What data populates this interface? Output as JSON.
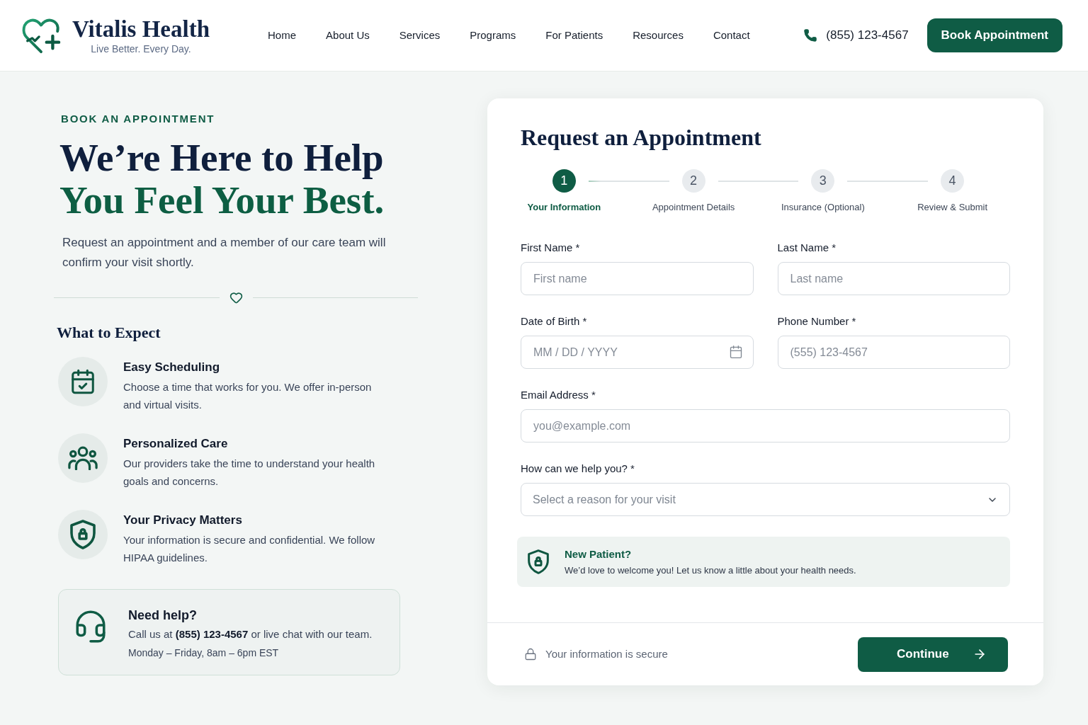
{
  "header": {
    "brand": {
      "name": "Vitalis Health",
      "tagline": "Live Better. Every Day."
    },
    "nav": [
      "Home",
      "About Us",
      "Services",
      "Programs",
      "For Patients",
      "Resources",
      "Contact"
    ],
    "phone": "(855) 123-4567",
    "cta": "Book Appointment"
  },
  "intro": {
    "eyebrow": "BOOK AN APPOINTMENT",
    "headline": [
      {
        "kind": "dark",
        "text": "We’re Here to Help"
      },
      {
        "kind": "accent",
        "text": "You Feel Your Best."
      }
    ],
    "lead": "Request an appointment and a member of our care team will confirm your visit shortly.",
    "expect_title": "What to Expect",
    "features": [
      {
        "kind": "calendar",
        "title": "Easy Scheduling",
        "text": "Choose a time that works for you. We offer in-person and virtual visits."
      },
      {
        "kind": "people",
        "title": "Personalized Care",
        "text": "Our providers take the time to understand your health goals and concerns."
      },
      {
        "kind": "privacy",
        "title": "Your Privacy Matters",
        "text": "Your information is secure and confidential. We follow HIPAA guidelines."
      }
    ],
    "help": {
      "title": "Need help?",
      "text": "Call us at **(855) 123-4567** or live chat with our team.",
      "hours": "Monday – Friday, 8am – 6pm EST"
    }
  },
  "form": {
    "title": "Request an Appointment",
    "steps": [
      {
        "number": "1",
        "label": "Your Information",
        "selected": true
      },
      {
        "number": "2",
        "label": "Appointment Details",
        "selected": false
      },
      {
        "number": "3",
        "label": "Insurance (Optional)",
        "selected": false
      },
      {
        "number": "4",
        "label": "Review & Submit",
        "selected": false
      }
    ],
    "rows": [
      [
        {
          "kind": "text",
          "label": "First Name *",
          "placeholder": "First name"
        },
        {
          "kind": "text",
          "label": "Last Name *",
          "placeholder": "Last name"
        }
      ],
      [
        {
          "kind": "date",
          "label": "Date of Birth *",
          "placeholder": "MM / DD / YYYY"
        },
        {
          "kind": "text",
          "label": "Phone Number *",
          "placeholder": "(555) 123-4567"
        }
      ],
      [
        {
          "kind": "text",
          "label": "Email Address *",
          "placeholder": "you@example.com"
        }
      ],
      [
        {
          "kind": "select",
          "label": "How can we help you? *",
          "placeholder": "Select a reason for your visit"
        }
      ]
    ],
    "notice": {
      "title": "New Patient?",
      "text": "We’d love to welcome you! Let us know a little about your health needs."
    },
    "footer": {
      "secure_note": "Your information is secure",
      "button": "Continue"
    }
  }
}
